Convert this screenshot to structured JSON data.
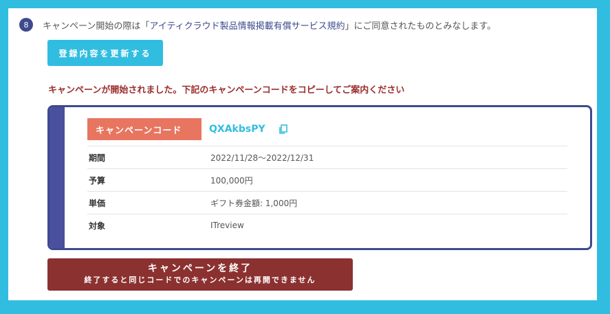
{
  "step": {
    "number": "8",
    "text_before": "キャンペーン開始の際は「",
    "link": "アイティクラウド製品情報掲載有償サービス規約",
    "text_after": "」にご同意されたものとみなします。"
  },
  "update_button": "登録内容を更新する",
  "notice": "キャンペーンが開始されました。下記のキャンペーンコードをコピーしてご案内ください",
  "campaign": {
    "code_label": "キャンペーンコード",
    "code_value": "QXAkbsPY",
    "copy_icon": "copy-icon",
    "rows": [
      {
        "label": "期間",
        "value": "2022/11/28～2022/12/31"
      },
      {
        "label": "予算",
        "value": "100,000円"
      },
      {
        "label": "単価",
        "value": "ギフト券金額: 1,000円"
      },
      {
        "label": "対象",
        "value": "ITreview"
      }
    ]
  },
  "end_button": {
    "title": "キャンペーンを終了",
    "subtitle": "終了すると同じコードでのキャンペーンは再開できません"
  },
  "colors": {
    "frame": "#31bde0",
    "navy": "#3d4a8e",
    "label_bg": "#e87560",
    "notice": "#9b2d2d",
    "end_button": "#8b3130"
  }
}
